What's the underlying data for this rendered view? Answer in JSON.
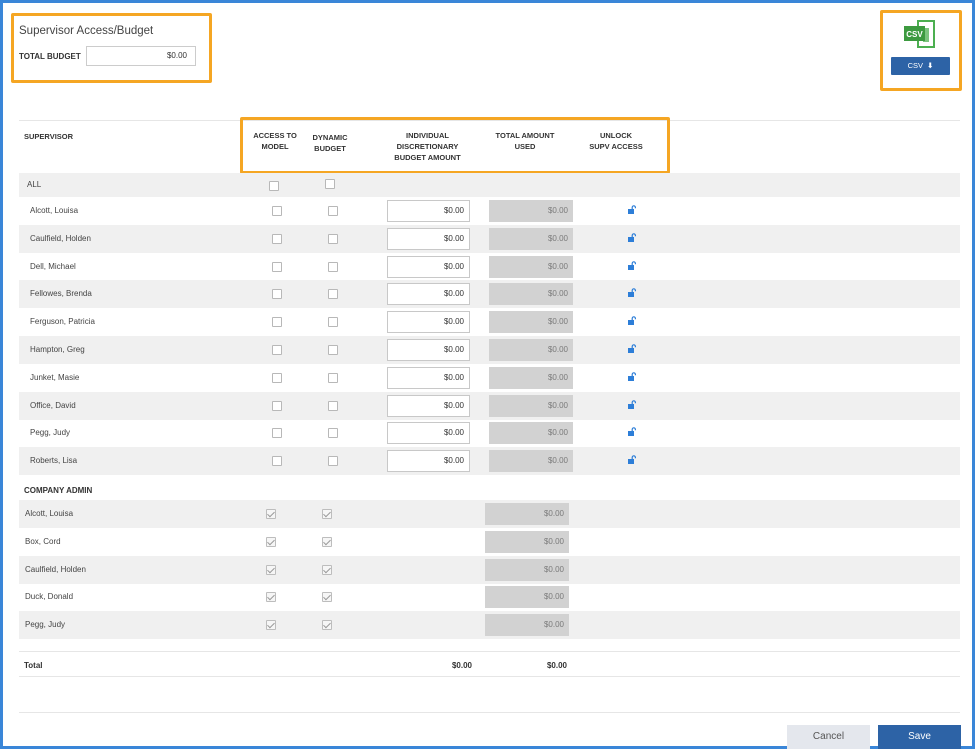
{
  "header": {
    "title": "Supervisor Access/Budget",
    "total_budget_label": "TOTAL BUDGET",
    "total_budget_value": "$0.00"
  },
  "export": {
    "icon_text": "CSV",
    "button_label": "CSV",
    "icon": "download-icon"
  },
  "columns": {
    "supervisor": "SUPERVISOR",
    "access_to_model": [
      "ACCESS TO",
      "MODEL"
    ],
    "dynamic_budget": [
      "DYNAMIC",
      "BUDGET"
    ],
    "individual_budget": [
      "INDIVIDUAL",
      "DISCRETIONARY",
      "BUDGET AMOUNT"
    ],
    "total_used": [
      "TOTAL AMOUNT",
      "USED"
    ],
    "unlock": [
      "UNLOCK",
      "SUPV ACCESS"
    ]
  },
  "all_row_label": "ALL",
  "supervisors": [
    {
      "name": "Alcott, Louisa",
      "budget": "$0.00",
      "used": "$0.00"
    },
    {
      "name": "Caulfield, Holden",
      "budget": "$0.00",
      "used": "$0.00"
    },
    {
      "name": "Dell, Michael",
      "budget": "$0.00",
      "used": "$0.00"
    },
    {
      "name": "Fellowes, Brenda",
      "budget": "$0.00",
      "used": "$0.00"
    },
    {
      "name": "Ferguson, Patricia",
      "budget": "$0.00",
      "used": "$0.00"
    },
    {
      "name": "Hampton, Greg",
      "budget": "$0.00",
      "used": "$0.00"
    },
    {
      "name": "Junket, Masie",
      "budget": "$0.00",
      "used": "$0.00"
    },
    {
      "name": "Office, David",
      "budget": "$0.00",
      "used": "$0.00"
    },
    {
      "name": "Pegg, Judy",
      "budget": "$0.00",
      "used": "$0.00"
    },
    {
      "name": "Roberts, Lisa",
      "budget": "$0.00",
      "used": "$0.00"
    }
  ],
  "company_admin_label": "COMPANY ADMIN",
  "admins": [
    {
      "name": "Alcott, Louisa",
      "used": "$0.00"
    },
    {
      "name": "Box, Cord",
      "used": "$0.00"
    },
    {
      "name": "Caulfield, Holden",
      "used": "$0.00"
    },
    {
      "name": "Duck, Donald",
      "used": "$0.00"
    },
    {
      "name": "Pegg, Judy",
      "used": "$0.00"
    }
  ],
  "totals": {
    "label": "Total",
    "budget": "$0.00",
    "used": "$0.00"
  },
  "footer": {
    "cancel_label": "Cancel",
    "save_label": "Save"
  },
  "colors": {
    "frame": "#3a86d8",
    "highlight": "#f5a623",
    "primary": "#2d63a6",
    "csv_green": "#4caf50"
  }
}
